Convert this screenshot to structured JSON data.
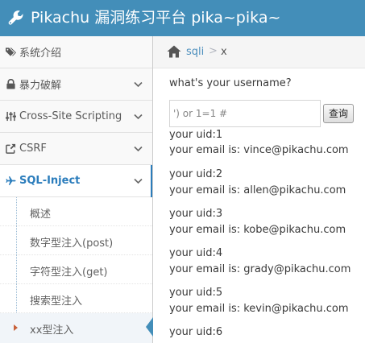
{
  "app": {
    "title": "Pikachu 漏洞练习平台 pika~pika~",
    "accent_color": "#438eb9",
    "title_icon": "wrench-icon"
  },
  "sidebar": {
    "items": [
      {
        "label": "系统介绍",
        "icon": "tags-icon",
        "has_chevron": false,
        "active": false
      },
      {
        "label": "暴力破解",
        "icon": "lock-icon",
        "has_chevron": true,
        "active": false
      },
      {
        "label": "Cross-Site Scripting",
        "icon": "sliders-icon",
        "has_chevron": true,
        "active": false
      },
      {
        "label": "CSRF",
        "icon": "share-square-icon",
        "has_chevron": true,
        "active": false
      },
      {
        "label": "SQL-Inject",
        "icon": "plane-icon",
        "has_chevron": true,
        "active": true
      }
    ],
    "sub_items": [
      {
        "label": "概述",
        "active": false
      },
      {
        "label": "数字型注入(post)",
        "active": false
      },
      {
        "label": "字符型注入(get)",
        "active": false
      },
      {
        "label": "搜索型注入",
        "active": false
      },
      {
        "label": "xx型注入",
        "active": true
      }
    ]
  },
  "breadcrumb": {
    "home_icon": "home-icon",
    "link": "sqli",
    "separator": ">",
    "current": "x"
  },
  "form": {
    "question": "what's your username?",
    "input_value": "') or 1=1 #",
    "button_label": "查询"
  },
  "results": [
    {
      "uid": "your uid:1",
      "email": "your email is: vince@pikachu.com"
    },
    {
      "uid": "your uid:2",
      "email": "your email is: allen@pikachu.com"
    },
    {
      "uid": "your uid:3",
      "email": "your email is: kobe@pikachu.com"
    },
    {
      "uid": "your uid:4",
      "email": "your email is: grady@pikachu.com"
    },
    {
      "uid": "your uid:5",
      "email": "your email is: kevin@pikachu.com"
    },
    {
      "uid": "your uid:6",
      "email": ""
    }
  ]
}
